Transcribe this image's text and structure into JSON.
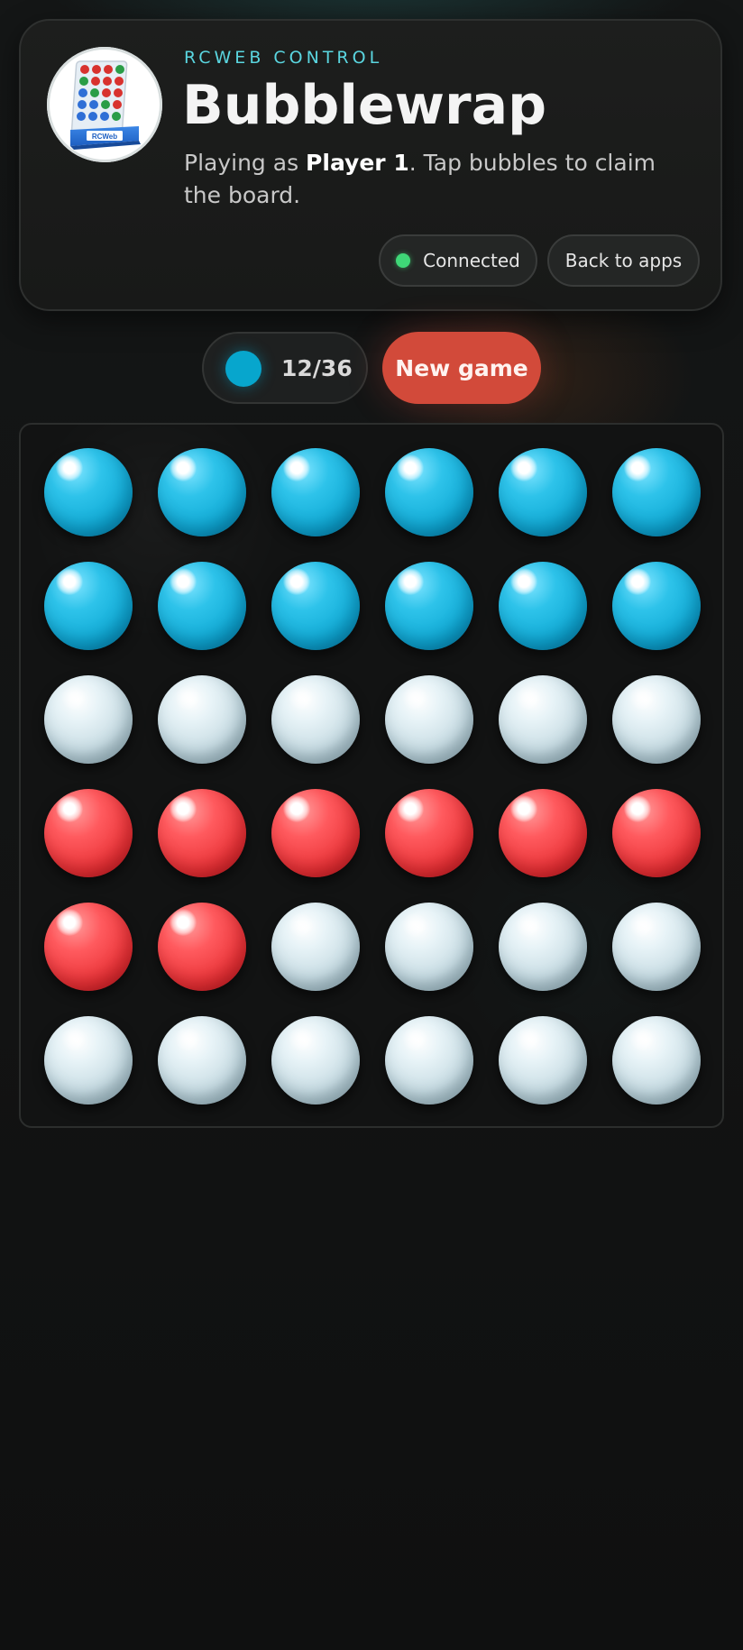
{
  "header": {
    "eyebrow": "RCWEB CONTROL",
    "title": "Bubblewrap",
    "subtitle_prefix": "Playing as ",
    "player_name": "Player 1",
    "subtitle_suffix": ". Tap bubbles to claim the board.",
    "logo_label": "RCWeb",
    "status_label": "Connected",
    "status_color": "#3fd777",
    "back_label": "Back to apps"
  },
  "scorebar": {
    "player_color": "#07a6cd",
    "score_text": "12/36",
    "new_game_label": "New game",
    "new_game_color": "#d24a3a"
  },
  "colors": {
    "blue": "#0fa9d4",
    "red": "#ea3438",
    "empty": "#d6e6eb"
  },
  "board": {
    "columns": 6,
    "rows": 6,
    "cells": [
      "blue",
      "blue",
      "blue",
      "blue",
      "blue",
      "blue",
      "blue",
      "blue",
      "blue",
      "blue",
      "blue",
      "blue",
      "empty",
      "empty",
      "empty",
      "empty",
      "empty",
      "empty",
      "red",
      "red",
      "red",
      "red",
      "red",
      "red",
      "red",
      "red",
      "empty",
      "empty",
      "empty",
      "empty",
      "empty",
      "empty",
      "empty",
      "empty",
      "empty",
      "empty"
    ]
  }
}
